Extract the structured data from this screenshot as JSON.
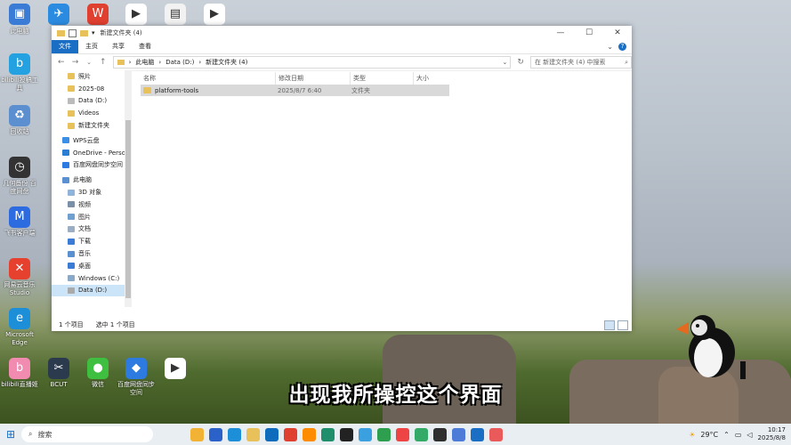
{
  "desktop": {
    "icons_top": [
      {
        "label": "",
        "color": "#3a7bd5",
        "glyph": "▣"
      },
      {
        "label": "",
        "color": "#2b8be0",
        "glyph": "✈"
      },
      {
        "label": "",
        "color": "#e0402f",
        "glyph": "W"
      },
      {
        "label": "",
        "color": "#ffffff",
        "glyph": "▶"
      },
      {
        "label": "",
        "color": "#f2f2f2",
        "glyph": "▤"
      },
      {
        "label": "",
        "color": "#ffffff",
        "glyph": "▶"
      }
    ],
    "partial_label": "此电脑",
    "icons_left": [
      {
        "label": "bilibili投稿工具",
        "color": "#23a1e0",
        "glyph": "b"
      },
      {
        "label": "回收站",
        "color": "#5b8fd0",
        "glyph": "♻"
      },
      {
        "label": "几何备份 百度网盘",
        "color": "#333333",
        "glyph": "◷"
      },
      {
        "label": "飞书客户端",
        "color": "#2d6be0",
        "glyph": "M"
      },
      {
        "label": "网易云音乐 Studio",
        "color": "#e6402e",
        "glyph": "✕"
      },
      {
        "label": "Microsoft Edge",
        "color": "#1c8fd8",
        "glyph": "e"
      }
    ],
    "icons_bottom": [
      {
        "label": "bilibili直播姬",
        "color": "#f28bb0",
        "glyph": "b"
      },
      {
        "label": "BCUT",
        "color": "#2c3a4d",
        "glyph": "✂"
      },
      {
        "label": "微信",
        "color": "#3fbf3f",
        "glyph": "●"
      },
      {
        "label": "百度网盘同步空间",
        "color": "#2d7be0",
        "glyph": "◆"
      },
      {
        "label": "",
        "color": "#ffffff",
        "glyph": "▶"
      }
    ]
  },
  "explorer": {
    "title": "新建文件夹 (4)",
    "ribbon_tabs": [
      "文件",
      "主页",
      "共享",
      "查看"
    ],
    "address": {
      "crumbs": [
        "此电脑",
        "Data (D:)",
        "新建文件夹 (4)"
      ],
      "refresh": "↻"
    },
    "search_placeholder": "在 新建文件夹 (4) 中搜索",
    "sidebar": [
      {
        "label": "照片",
        "color": "#e8c15a",
        "indent": 1
      },
      {
        "label": "2025-08",
        "color": "#e8c15a",
        "indent": 1
      },
      {
        "label": "Data (D:)",
        "color": "#bbbbbb",
        "indent": 1
      },
      {
        "label": "Videos",
        "color": "#e8c15a",
        "indent": 1
      },
      {
        "label": "新建文件夹",
        "color": "#e8c15a",
        "indent": 1
      },
      {
        "label": "WPS云盘",
        "color": "#3a8ee6",
        "indent": 0
      },
      {
        "label": "OneDrive - Perso",
        "color": "#2b7cd3",
        "indent": 0
      },
      {
        "label": "百度网盘同步空间",
        "color": "#2d7be0",
        "indent": 0
      },
      {
        "label": "此电脑",
        "color": "#5a8fd0",
        "indent": 0
      },
      {
        "label": "3D 对象",
        "color": "#8fb3d9",
        "indent": 1
      },
      {
        "label": "视频",
        "color": "#7a8fa8",
        "indent": 1
      },
      {
        "label": "图片",
        "color": "#6fa0d0",
        "indent": 1
      },
      {
        "label": "文档",
        "color": "#9aaec5",
        "indent": 1
      },
      {
        "label": "下载",
        "color": "#3a7bd5",
        "indent": 1
      },
      {
        "label": "音乐",
        "color": "#5a8fd0",
        "indent": 1
      },
      {
        "label": "桌面",
        "color": "#3a7bd5",
        "indent": 1
      },
      {
        "label": "Windows (C:)",
        "color": "#8aa9c8",
        "indent": 1
      },
      {
        "label": "Data (D:)",
        "color": "#aaaaaa",
        "indent": 1,
        "selected": true
      }
    ],
    "columns": [
      "名称",
      "修改日期",
      "类型",
      "大小"
    ],
    "files": [
      {
        "name": "platform-tools",
        "date": "2025/8/7 6:40",
        "type": "文件夹",
        "size": ""
      }
    ],
    "status": {
      "count": "1 个项目",
      "selected": "选中 1 个项目"
    }
  },
  "subtitle": "出现我所操控这个界面",
  "taskbar": {
    "search_label": "搜索",
    "apps": [
      "#f2b233",
      "#2a62c9",
      "#1c8fd8",
      "#e8c15a",
      "#0f6cbd",
      "#e0402f",
      "#ff8c00",
      "#1e8f6a",
      "#222222",
      "#3aa0e0",
      "#2e9f4e",
      "#ee4444",
      "#33aa66",
      "#2f2f2f",
      "#4c7bd8",
      "#1a6fc4",
      "#ea5a5a"
    ],
    "weather": "29°C",
    "time": "10:17",
    "date": "2025/8/8"
  }
}
